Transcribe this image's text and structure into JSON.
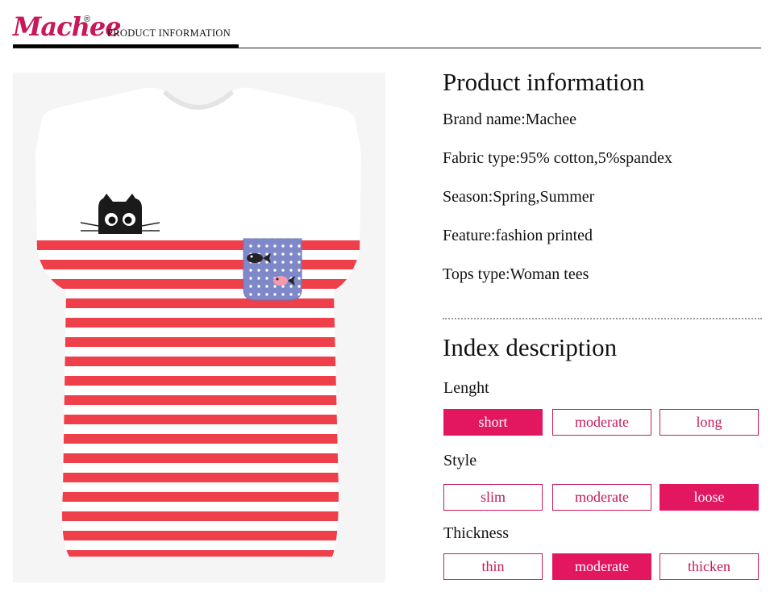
{
  "header": {
    "logo": "Machee",
    "logo_mark": "®",
    "title": "PRODUCT INFORMATION"
  },
  "product_info": {
    "title": "Product information",
    "rows": [
      "Brand name:Machee",
      "Fabric type:95% cotton,5%spandex",
      "Season:Spring,Summer",
      "Feature:fashion printed",
      "Tops type:Woman tees"
    ]
  },
  "index_description": {
    "title": "Index description",
    "groups": [
      {
        "label": "Lenght",
        "options": [
          "short",
          "moderate",
          "long"
        ],
        "selected": "short"
      },
      {
        "label": "Style",
        "options": [
          "slim",
          "moderate",
          "loose"
        ],
        "selected": "loose"
      },
      {
        "label": "Thickness",
        "options": [
          "thin",
          "moderate",
          "thicken"
        ],
        "selected": "moderate"
      }
    ]
  },
  "colors": {
    "accent": "#e2175f",
    "stripe": "#ee3f4a"
  }
}
